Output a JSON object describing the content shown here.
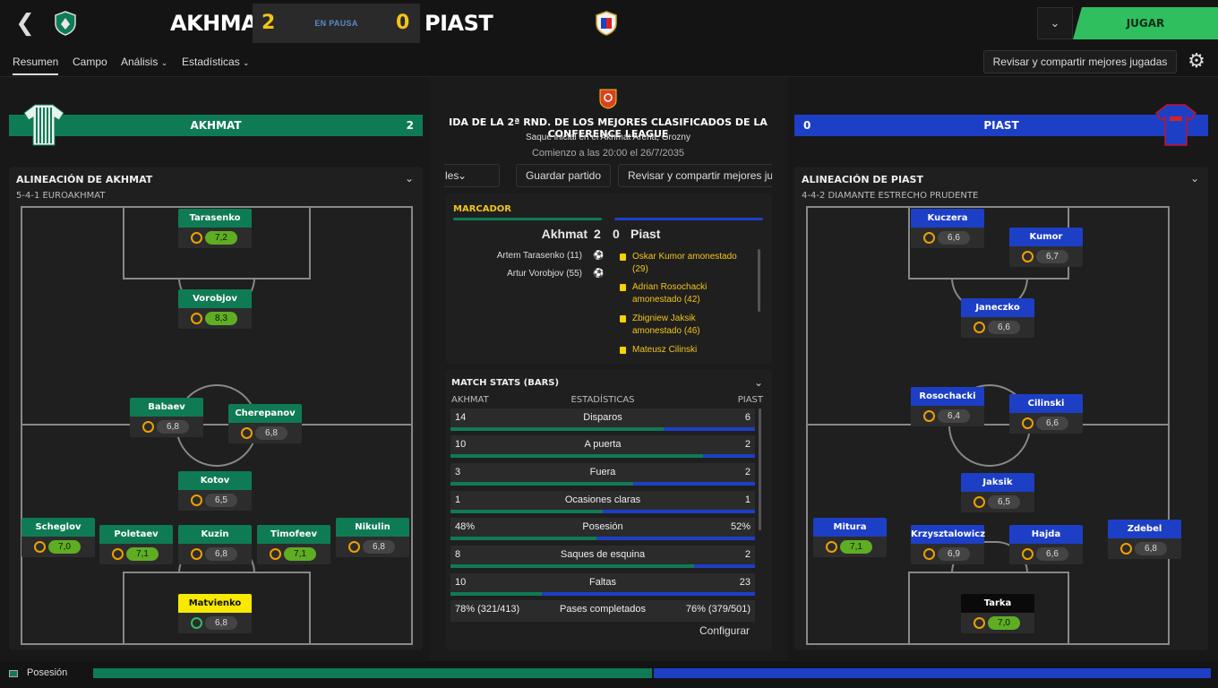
{
  "header": {
    "home_team": "AKHMAT",
    "home_score": "2",
    "status": "EN PAUSA",
    "away_score": "0",
    "away_team": "PIAST",
    "play_label": "JUGAR"
  },
  "tabs": [
    {
      "label": "Resumen"
    },
    {
      "label": "Campo"
    },
    {
      "label": "Análisis"
    },
    {
      "label": "Estadísticas"
    }
  ],
  "share_label": "Revisar y compartir mejores jugadas",
  "home": {
    "banner_name": "AKHMAT",
    "banner_score": "2",
    "lineup_title": "ALINEACIÓN DE AKHMAT",
    "formation": "5-4-1 EUROAKHMAT",
    "players": [
      {
        "name": "Tarasenko",
        "rating": "7,2",
        "good": true
      },
      {
        "name": "Vorobjov",
        "rating": "8,3",
        "good": true
      },
      {
        "name": "Babaev",
        "rating": "6,8",
        "good": false
      },
      {
        "name": "Cherepanov",
        "rating": "6,8",
        "good": false
      },
      {
        "name": "Kotov",
        "rating": "6,5",
        "good": false
      },
      {
        "name": "Scheglov",
        "rating": "7,0",
        "good": true
      },
      {
        "name": "Poletaev",
        "rating": "7,1",
        "good": true
      },
      {
        "name": "Kuzin",
        "rating": "6,8",
        "good": false
      },
      {
        "name": "Timofeev",
        "rating": "7,1",
        "good": true
      },
      {
        "name": "Nikulin",
        "rating": "6,8",
        "good": false
      },
      {
        "name": "Matvienko",
        "rating": "6,8",
        "good": false
      }
    ]
  },
  "away": {
    "banner_name": "PIAST",
    "banner_score": "0",
    "lineup_title": "ALINEACIÓN DE PIAST",
    "formation": "4-4-2 DIAMANTE ESTRECHO PRUDENTE",
    "players": [
      {
        "name": "Kuczera",
        "rating": "6,6",
        "good": false
      },
      {
        "name": "Kumor",
        "rating": "6,7",
        "good": false
      },
      {
        "name": "Janeczko",
        "rating": "6,6",
        "good": false
      },
      {
        "name": "Rosochacki",
        "rating": "6,4",
        "good": false
      },
      {
        "name": "Cilinski",
        "rating": "6,6",
        "good": false
      },
      {
        "name": "Jaksik",
        "rating": "6,5",
        "good": false
      },
      {
        "name": "Mitura",
        "rating": "7,1",
        "good": true
      },
      {
        "name": "Krzysztalowicz",
        "rating": "6,9",
        "good": false
      },
      {
        "name": "Hajda",
        "rating": "6,6",
        "good": false
      },
      {
        "name": "Zdebel",
        "rating": "6,8",
        "good": false
      },
      {
        "name": "Tarka",
        "rating": "7,0",
        "good": true
      }
    ]
  },
  "match_info": {
    "competition": "IDA DE LA 2ª RND. DE LOS MEJORES CLASIFICADOS DE LA CONFERENCE LEAGUE",
    "kickoff_venue": "Saque inicial en el Akhmat Arena, Grozny",
    "kickoff_time": "Comienzo a las 20:00 el 26/7/2035"
  },
  "controls": {
    "partial_label": "les",
    "save_match": "Guardar partido",
    "share_partial": "Revisar y compartir mejores ju"
  },
  "scoreboard": {
    "title": "MARCADOR",
    "home": "Akhmat",
    "home_score": "2",
    "away_score": "0",
    "away": "Piast",
    "goals": [
      "Artem Tarasenko (11)",
      "Artur Vorobjov (55)"
    ],
    "events": [
      {
        "l1": "Oskar Kumor amonestado",
        "l2": "(29)"
      },
      {
        "l1": "Adrian Rosochacki",
        "l2": "amonestado (42)"
      },
      {
        "l1": "Zbigniew Jaksik",
        "l2": "amonestado (46)"
      },
      {
        "l1": "Mateusz Cilinski",
        "l2": ""
      }
    ]
  },
  "stats": {
    "title": "MATCH STATS (BARS)",
    "head_home": "AKHMAT",
    "head_mid": "ESTADÍSTICAS",
    "head_away": "PIAST",
    "rows": [
      {
        "home": "14",
        "label": "Disparos",
        "away": "6",
        "share": 0.7
      },
      {
        "home": "10",
        "label": "A puerta",
        "away": "2",
        "share": 0.83
      },
      {
        "home": "3",
        "label": "Fuera",
        "away": "2",
        "share": 0.6
      },
      {
        "home": "1",
        "label": "Ocasiones claras",
        "away": "1",
        "share": 0.5
      },
      {
        "home": "48%",
        "label": "Posesión",
        "away": "52%",
        "share": 0.48
      },
      {
        "home": "8",
        "label": "Saques de esquina",
        "away": "2",
        "share": 0.8
      },
      {
        "home": "10",
        "label": "Faltas",
        "away": "23",
        "share": 0.3
      },
      {
        "home": "78% (321/413)",
        "label": "Pases completados",
        "away": "76% (379/501)",
        "share": null
      }
    ],
    "configure": "Configurar"
  },
  "footer": {
    "label": "Posesión",
    "home_share": 0.5
  },
  "colors": {
    "home": "#0f7b55",
    "away": "#1d3fc5",
    "play": "#2fbf5f",
    "score": "#f2c418"
  }
}
